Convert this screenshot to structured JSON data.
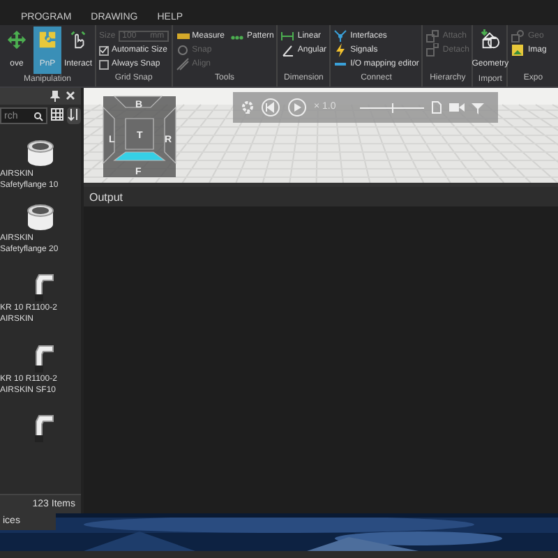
{
  "menu": [
    {
      "label": "PROGRAM"
    },
    {
      "label": "DRAWING"
    },
    {
      "label": "HELP"
    }
  ],
  "ribbon": [
    {
      "label": "Manipulation",
      "items": [
        {
          "kind": "big",
          "label": "ove",
          "selected": false
        },
        {
          "kind": "big",
          "label": "PnP",
          "selected": true
        },
        {
          "kind": "big",
          "label": "Interact",
          "selected": false
        }
      ]
    },
    {
      "label": "Grid Snap",
      "items": [
        {
          "kind": "field",
          "label": "Size",
          "value": "100",
          "unit": "mm",
          "disabled": true
        },
        {
          "kind": "check",
          "label": "Automatic Size",
          "checked": true
        },
        {
          "kind": "check",
          "label": "Always Snap",
          "checked": false
        }
      ]
    },
    {
      "label": "Tools",
      "items": [
        {
          "kind": "small",
          "label": "Measure",
          "disabled": false
        },
        {
          "kind": "small",
          "label": "Snap",
          "disabled": true
        },
        {
          "kind": "small",
          "label": "Align",
          "disabled": true
        },
        {
          "kind": "small",
          "label": "Pattern",
          "disabled": false
        }
      ]
    },
    {
      "label": "Dimension",
      "items": [
        {
          "kind": "small",
          "label": "Linear",
          "disabled": false
        },
        {
          "kind": "small",
          "label": "Angular",
          "disabled": false
        }
      ]
    },
    {
      "label": "Connect",
      "items": [
        {
          "kind": "small",
          "label": "Interfaces",
          "disabled": false
        },
        {
          "kind": "small",
          "label": "Signals",
          "disabled": false
        },
        {
          "kind": "small",
          "label": "I/O mapping editor",
          "disabled": false
        }
      ]
    },
    {
      "label": "Hierarchy",
      "items": [
        {
          "kind": "small",
          "label": "Attach",
          "disabled": true
        },
        {
          "kind": "small",
          "label": "Detach",
          "disabled": true
        }
      ]
    },
    {
      "label": "Import",
      "items": [
        {
          "kind": "big",
          "label": "Geometry",
          "selected": false
        }
      ]
    },
    {
      "label": "Expo",
      "items": [
        {
          "kind": "small",
          "label": "Geo",
          "disabled": true
        },
        {
          "kind": "small",
          "label": "Imag",
          "disabled": false
        }
      ]
    }
  ],
  "library": {
    "search": {
      "placeholder": "rch"
    },
    "items": [
      {
        "kind": "flange",
        "lines": [
          "AIRSKIN",
          "Safetyflange 10"
        ]
      },
      {
        "kind": "flange",
        "lines": [
          "AIRSKIN",
          "Safetyflange 20"
        ]
      },
      {
        "kind": "robot",
        "lines": [
          "KR 10 R1100-2",
          "AIRSKIN"
        ]
      },
      {
        "kind": "robot",
        "lines": [
          "KR 10 R1100-2",
          "AIRSKIN SF10"
        ]
      },
      {
        "kind": "robot"
      }
    ],
    "count": "123 Items",
    "tab": "ices"
  },
  "viewcube": {
    "faces": [
      {
        "label": "B",
        "selected": false
      },
      {
        "label": "L",
        "selected": false
      },
      {
        "label": "T",
        "selected": false
      },
      {
        "label": "R",
        "selected": false
      },
      {
        "label": "F",
        "selected": true
      }
    ]
  },
  "playback": {
    "speed": "× 1.0",
    "level": 0.5
  },
  "output": {
    "title": "Output"
  }
}
